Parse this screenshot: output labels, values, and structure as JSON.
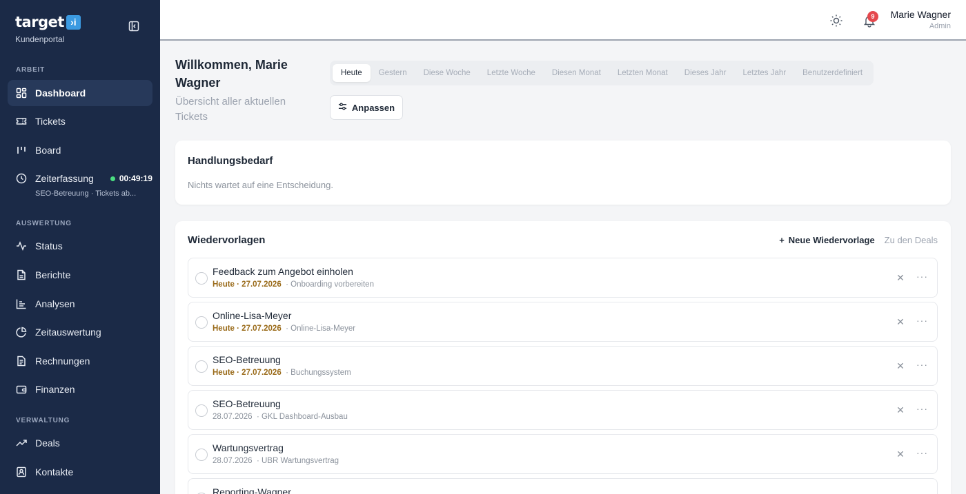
{
  "brand": {
    "logo_text": "target",
    "logo_mark": "›i",
    "subtitle": "Kundenportal"
  },
  "sidebar": {
    "sections": [
      "ARBEIT",
      "AUSWERTUNG",
      "VERWALTUNG"
    ],
    "items": [
      {
        "label": "Dashboard",
        "icon": "dashboard-icon"
      },
      {
        "label": "Tickets",
        "icon": "ticket-icon"
      },
      {
        "label": "Board",
        "icon": "board-icon"
      },
      {
        "label": "Status",
        "icon": "activity-icon"
      },
      {
        "label": "Berichte",
        "icon": "report-icon"
      },
      {
        "label": "Analysen",
        "icon": "chart-icon"
      },
      {
        "label": "Zeitauswertung",
        "icon": "pie-icon"
      },
      {
        "label": "Rechnungen",
        "icon": "invoice-icon"
      },
      {
        "label": "Finanzen",
        "icon": "wallet-icon"
      },
      {
        "label": "Deals",
        "icon": "trend-icon"
      },
      {
        "label": "Kontakte",
        "icon": "contact-icon"
      }
    ],
    "timer": {
      "label": "Zeiterfassung",
      "time": "00:49:19",
      "sub": "SEO-Betreuung · Tickets ab..."
    }
  },
  "header": {
    "notifications_count": "9",
    "user_name": "Marie Wagner",
    "user_role": "Admin"
  },
  "main": {
    "welcome_title": "Willkommen, Marie Wagner",
    "welcome_sub": "Übersicht aller aktuellen Tickets",
    "ranges": [
      "Heute",
      "Gestern",
      "Diese Woche",
      "Letzte Woche",
      "Diesen Monat",
      "Letzten Monat",
      "Dieses Jahr",
      "Letztes Jahr",
      "Benutzerdefiniert"
    ],
    "active_range": "Heute",
    "customize_label": "Anpassen"
  },
  "action_card": {
    "title": "Handlungsbedarf",
    "text": "Nichts wartet auf eine Entscheidung."
  },
  "followups": {
    "title": "Wiedervorlagen",
    "new_label": "Neue Wiedervorlage",
    "deals_label": "Zu den Deals",
    "items": [
      {
        "title": "Feedback zum Angebot einholen",
        "date": "Heute · 27.07.2026",
        "context": "· Onboarding vorbereiten",
        "today": true
      },
      {
        "title": "Online-Lisa-Meyer",
        "date": "Heute · 27.07.2026",
        "context": "· Online-Lisa-Meyer",
        "today": true
      },
      {
        "title": "SEO-Betreuung",
        "date": "Heute · 27.07.2026",
        "context": "· Buchungssystem",
        "today": true
      },
      {
        "title": "SEO-Betreuung",
        "date": "28.07.2026",
        "context": "· GKL Dashboard-Ausbau",
        "today": false
      },
      {
        "title": "Wartungsvertrag",
        "date": "28.07.2026",
        "context": "· UBR Wartungsvertrag",
        "today": false
      },
      {
        "title": "Reporting-Wagner",
        "date": "",
        "context": "",
        "today": false
      }
    ]
  },
  "colors": {
    "sidebar_bg": "#1b2a47",
    "active_item": "#27395a",
    "badge": "#e5484d",
    "today_date": "#9a6b1a",
    "timer_dot": "#4ade80"
  }
}
